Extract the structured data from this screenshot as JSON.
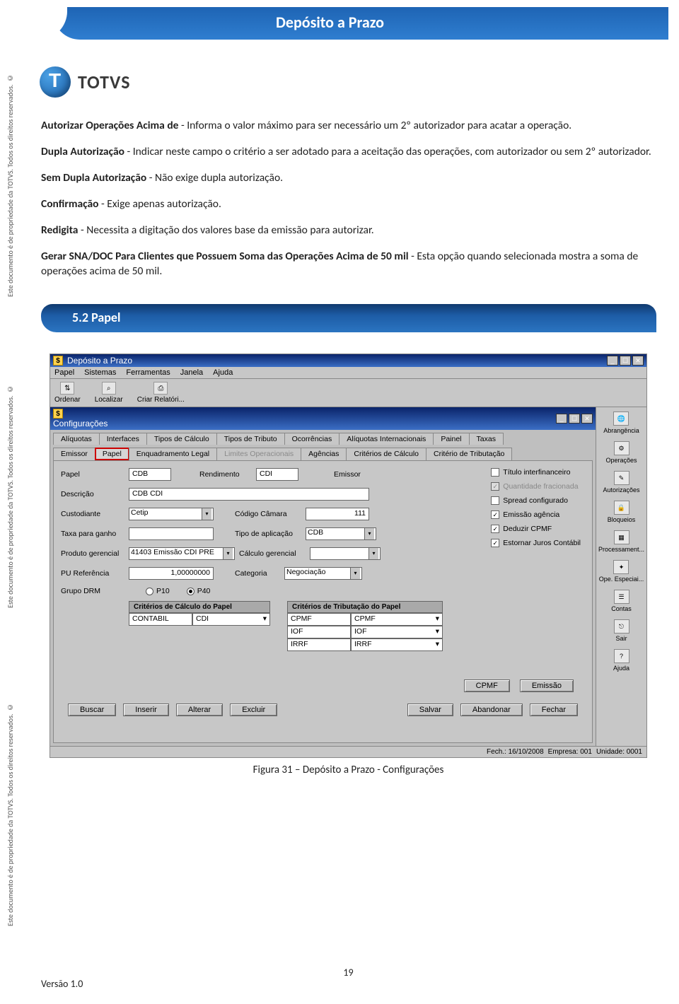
{
  "side_notice": "Este documento é de propriedade da TOTVS. Todos os direitos reservados. ©",
  "header_title": "Depósito a Prazo",
  "logo_text": "TOTVS",
  "paragraphs": {
    "p1a": "Autorizar Operações Acima de",
    "p1b": " - Informa o valor máximo para ser necessário um 2º autorizador  para acatar a operação.",
    "p2a": "Dupla Autorização",
    "p2b": " - Indicar neste campo o critério a ser adotado para a aceitação das operações, com autorizador ou sem 2º autorizador.",
    "p3a": "Sem Dupla Autorização",
    "p3b": " - Não exige dupla autorização.",
    "p4a": "Confirmação",
    "p4b": " - Exige apenas autorização.",
    "p5a": "Redigita",
    "p5b": " - Necessita a digitação dos valores base da emissão para autorizar.",
    "p6a": "Gerar SNA/DOC Para Clientes que Possuem Soma das Operações Acima de 50 mil",
    "p6b": " - Esta opção quando selecionada mostra a soma de operações acima de 50 mil."
  },
  "section": "5.2   Papel",
  "screenshot": {
    "outer_title": "Depósito a Prazo",
    "menu": [
      "Papel",
      "Sistemas",
      "Ferramentas",
      "Janela",
      "Ajuda"
    ],
    "toolbar": [
      "Ordenar",
      "Localizar",
      "Criar Relatóri..."
    ],
    "inner_title": "Configurações",
    "tabs_row1": [
      "Alíquotas",
      "Interfaces",
      "Tipos de Cálculo",
      "Tipos de Tributo",
      "Ocorrências",
      "Alíquotas Internacionais",
      "Painel",
      "Taxas"
    ],
    "tabs_row2": [
      "Emissor",
      "Papel",
      "Enquadramento Legal",
      "Limites Operacionais",
      "Agências",
      "Critérios de Cálculo",
      "Critério de Tributação"
    ],
    "fields": {
      "papel_label": "Papel",
      "papel_val": "CDB",
      "rend_label": "Rendimento",
      "rend_val": "CDI",
      "emissor_label": "Emissor",
      "desc_label": "Descrição",
      "desc_val": "CDB CDI",
      "cust_label": "Custodiante",
      "cust_val": "Cetip",
      "codcam_label": "Código Câmara",
      "codcam_val": "111",
      "taxa_label": "Taxa para ganho",
      "tipoap_label": "Tipo de aplicação",
      "tipoap_val": "CDB",
      "prod_label": "Produto gerencial",
      "prod_val": "41403 Emissão CDI PRE",
      "calc_label": "Cálculo gerencial",
      "pu_label": "PU Referência",
      "pu_val": "1,00000000",
      "cat_label": "Categoria",
      "cat_val": "Negociação",
      "drm_label": "Grupo DRM",
      "drm_p10": "P10",
      "drm_p40": "P40"
    },
    "checks": {
      "c1": "Título interfinanceiro",
      "c2": "Quantidade fracionada",
      "c3": "Spread configurado",
      "c4": "Emissão agência",
      "c5": "Deduzir CPMF",
      "c6": "Estornar Juros Contábil"
    },
    "grids": {
      "h1": "Critérios de Cálculo do Papel",
      "h2": "Critérios de Tributação do Papel",
      "g1a": "CONTABIL",
      "g1b": "CDI",
      "g2": [
        "CPMF",
        "IOF",
        "IRRF"
      ],
      "g2b": [
        "CPMF",
        "IOF",
        "IRRF"
      ]
    },
    "mid_buttons": [
      "CPMF",
      "Emissão"
    ],
    "bottom_left": [
      "Buscar",
      "Inserir",
      "Alterar",
      "Excluir"
    ],
    "bottom_right": [
      "Salvar",
      "Abandonar",
      "Fechar"
    ],
    "status": {
      "fech": "Fech.: 16/10/2008",
      "emp": "Empresa: 001",
      "un": "Unidade: 0001"
    },
    "right_icons": [
      "Abrangência",
      "Operações",
      "Autorizações",
      "Bloqueios",
      "Processament...",
      "Ope. Especiai...",
      "Contas",
      "Sair",
      "Ajuda"
    ]
  },
  "caption": "Figura 31 – Depósito a Prazo - Configurações",
  "version": "Versão 1.0",
  "page_number": "19"
}
